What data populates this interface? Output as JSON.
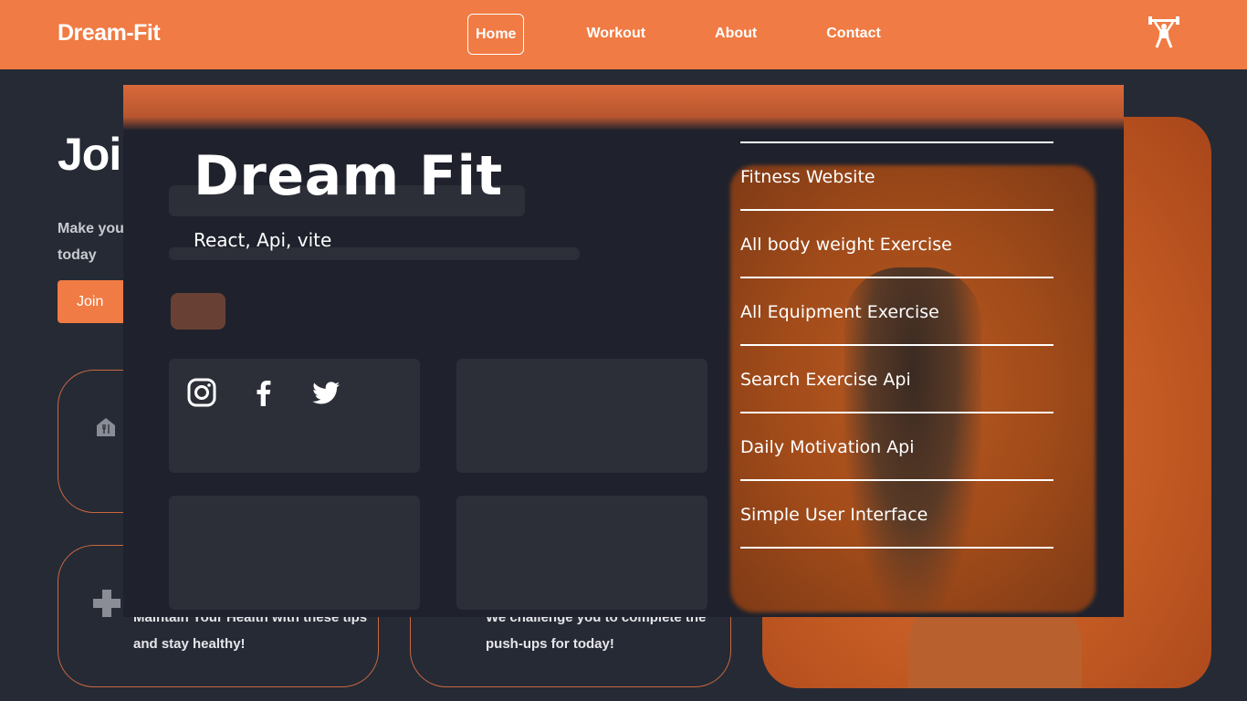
{
  "site": {
    "brand": "Dream-Fit",
    "nav": [
      "Home",
      "Workout",
      "About",
      "Contact"
    ],
    "active_nav": "Home",
    "hero_title": "Join",
    "hero_sub": "Make your f... today",
    "hero_sub_line1": "Make your f",
    "hero_sub_line2": "today",
    "hero_button": "Join",
    "card1_line1": "Maintain Your Health with these tips",
    "card1_line2": "and stay healthy!",
    "card2_line1": "We challenge you to complete the",
    "card2_line2": "push-ups for today!",
    "icons": [
      "weightlifter-icon",
      "food-icon",
      "health-plus-icon"
    ]
  },
  "modal": {
    "title": "Dream Fit",
    "stack": "React, Api, vite",
    "socials": [
      "instagram-icon",
      "facebook-icon",
      "twitter-icon"
    ],
    "features": [
      "Fitness Website",
      "All body weight Exercise",
      "All Equipment Exercise",
      "Search Exercise Api",
      "Daily Motivation Api",
      "Simple User Interface"
    ]
  },
  "colors": {
    "accent": "#f07b44",
    "background": "#262a35",
    "modal_bg": "#1f222c"
  }
}
